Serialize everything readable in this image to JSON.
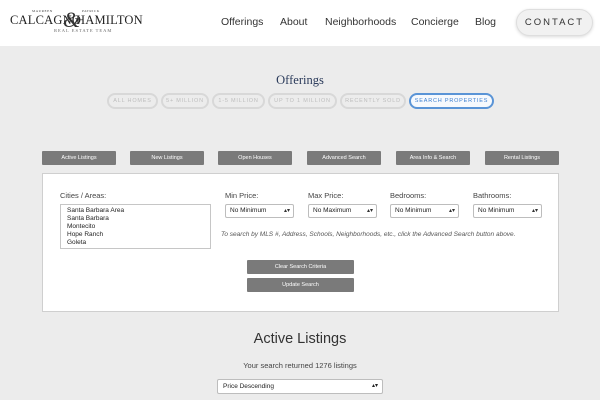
{
  "header": {
    "logo": {
      "small_left": "MAUREEN",
      "small_right": "PATRICK",
      "name_left": "CALCAGNO",
      "ampersand": "&",
      "name_right": "HAMILTON",
      "sub": "REAL ESTATE TEAM"
    },
    "nav": [
      "Offerings",
      "About",
      "Neighborhoods",
      "Concierge",
      "Blog"
    ],
    "contact_label": "CONTACT"
  },
  "offerings": {
    "title": "Offerings",
    "pills": [
      {
        "label": "ALL HOMES",
        "active": false
      },
      {
        "label": "5+ MILLION",
        "active": false
      },
      {
        "label": "1-5 MILLION",
        "active": false
      },
      {
        "label": "UP TO 1 MILLION",
        "active": false
      },
      {
        "label": "RECENTLY SOLD",
        "active": false
      },
      {
        "label": "SEARCH PROPERTIES",
        "active": true
      }
    ]
  },
  "tabs": [
    "Active Listings",
    "New Listings",
    "Open Houses",
    "Advanced Search",
    "Area Info & Search",
    "Rental Listings"
  ],
  "search": {
    "cities_label": "Cities / Areas:",
    "cities": [
      "Santa Barbara Area",
      "Santa Barbara",
      "Montecito",
      "Hope Ranch",
      "Goleta"
    ],
    "min_price_label": "Min Price:",
    "min_price_value": "No Minimum",
    "max_price_label": "Max Price:",
    "max_price_value": "No Maximum",
    "bedrooms_label": "Bedrooms:",
    "bedrooms_value": "No Minimum",
    "bathrooms_label": "Bathrooms:",
    "bathrooms_value": "No Minimum",
    "hint": "To search by MLS #, Address, Schools, Neighborhoods, etc., click the Advanced Search button above.",
    "clear_label": "Clear Search Criteria",
    "update_label": "Update Search",
    "select_arrow": "▴▾"
  },
  "results": {
    "title": "Active Listings",
    "count_text": "Your search returned 1276 listings",
    "sort_value": "Price Descending"
  },
  "colors": {
    "background": "#ececec",
    "button_gray": "#7a7a7a",
    "active_pill_blue": "#3c7fd0",
    "title_navy": "#2a3a5a"
  }
}
